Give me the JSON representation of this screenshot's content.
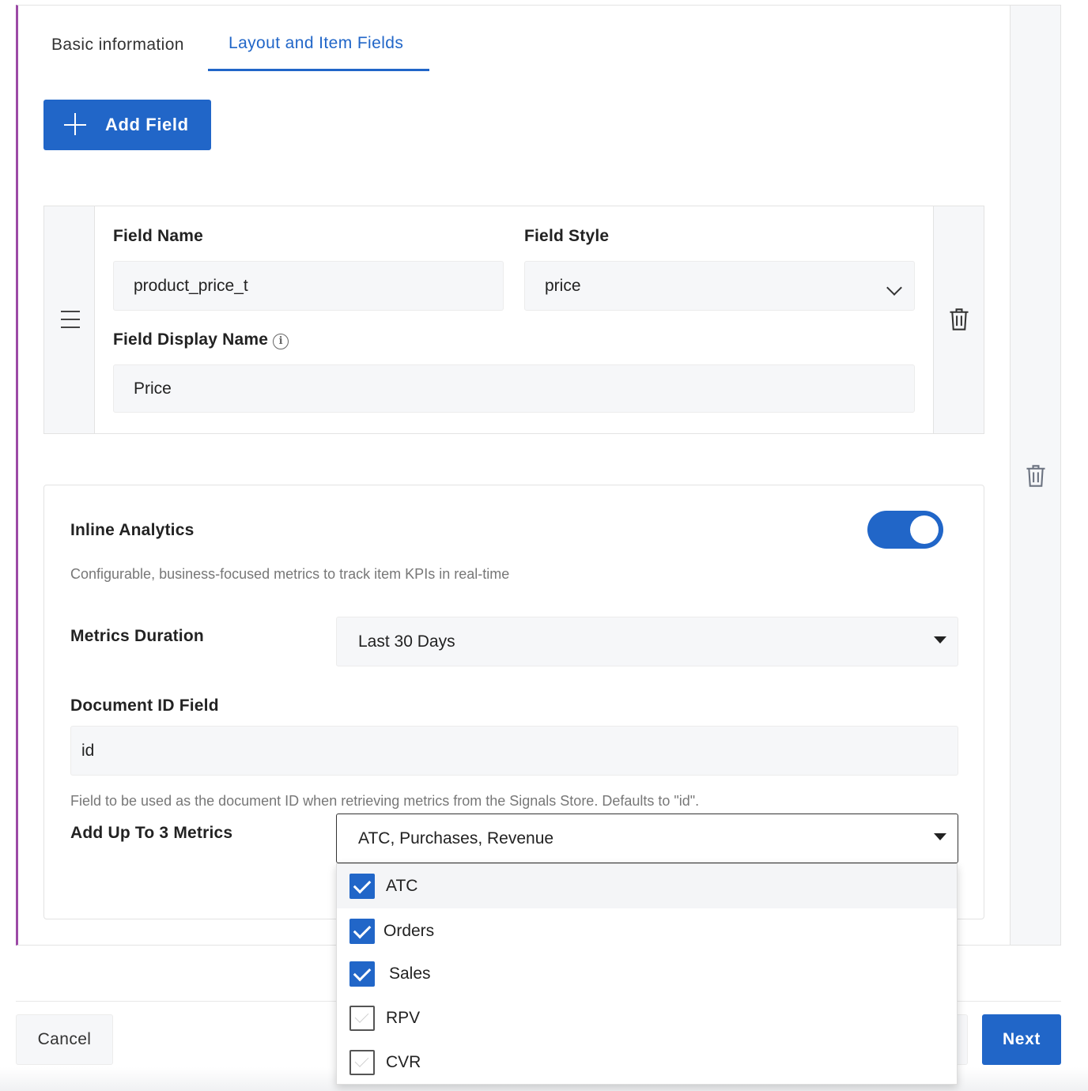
{
  "tabs": [
    {
      "label": "Basic information",
      "active": false
    },
    {
      "label": "Layout and Item Fields",
      "active": true
    }
  ],
  "add_field_button": {
    "label": "Add Field",
    "icon": "plus-icon"
  },
  "field_card": {
    "field_name_label": "Field Name",
    "field_name_value": "product_price_t",
    "field_style_label": "Field Style",
    "field_style_value": "price",
    "display_name_label": "Field Display Name",
    "display_name_value": "Price",
    "icons": {
      "drag": "hamburger-icon",
      "delete": "trash-icon",
      "info": "info-icon"
    }
  },
  "analytics": {
    "title": "Inline Analytics",
    "enabled": true,
    "description": "Configurable, business-focused metrics to track item KPIs in real-time",
    "metrics_duration_label": "Metrics Duration",
    "metrics_duration_value": "Last 30 Days",
    "doc_id_label": "Document ID Field",
    "doc_id_value": "id",
    "doc_id_help": "Field to be used as the document ID when retrieving metrics from the Signals Store. Defaults to \"id\".",
    "metrics_label": "Add Up To 3 Metrics",
    "metrics_value": "ATC, Purchases, Revenue",
    "options": [
      {
        "label": "ATC",
        "checked": true
      },
      {
        "label": "Orders",
        "checked": true
      },
      {
        "label": "Sales",
        "checked": true
      },
      {
        "label": "RPV",
        "checked": false
      },
      {
        "label": "CVR",
        "checked": false
      }
    ]
  },
  "footer": {
    "cancel_label": "Cancel",
    "next_label": "Next"
  },
  "colors": {
    "accent": "#2166c8",
    "panel_border": "#9c4aa6",
    "input_bg": "#f6f7f9"
  }
}
